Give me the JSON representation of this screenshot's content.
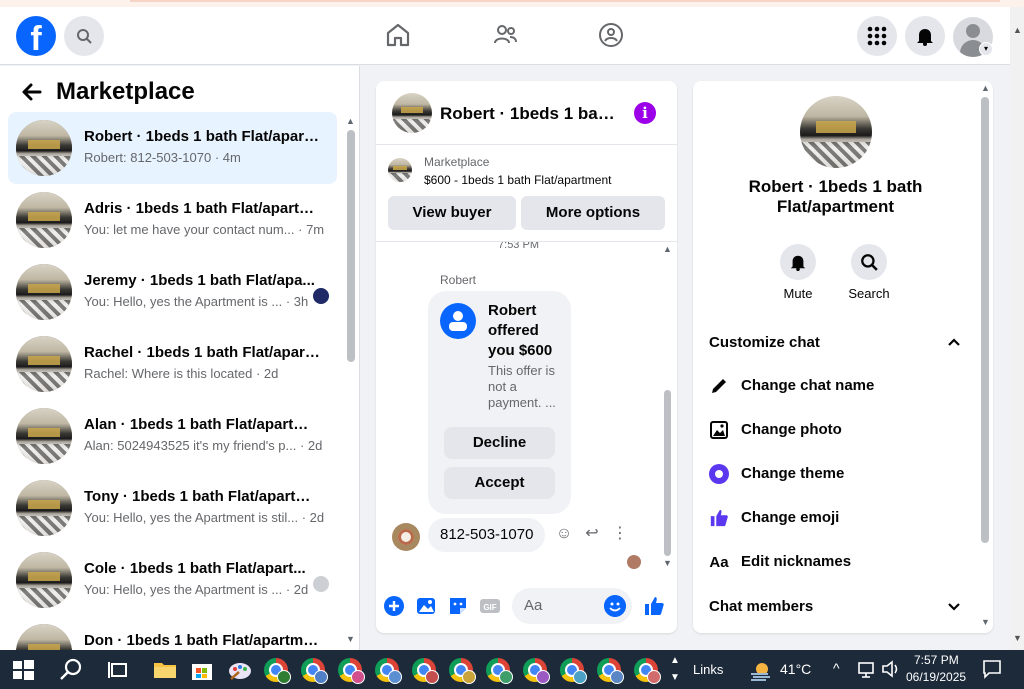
{
  "header": {
    "logo_letter": "f",
    "icons": [
      "search-icon",
      "home-icon",
      "friends-icon",
      "groups-icon",
      "menu-grid-icon",
      "bell-icon",
      "profile-avatar"
    ]
  },
  "left": {
    "title": "Marketplace",
    "threads": [
      {
        "name": "Robert · 1beds 1 bath Flat/apart...",
        "snippet": "Robert: 812-503-1070 · 4m",
        "active": true
      },
      {
        "name": "Adris · 1beds 1 bath Flat/apartm...",
        "snippet": "You: let me have your contact num... · 7m"
      },
      {
        "name": "Jeremy · 1beds 1 bath Flat/apa...",
        "snippet": "You: Hello, yes the Apartment is ... · 3h"
      },
      {
        "name": "Rachel · 1beds 1 bath Flat/apart...",
        "snippet": "Rachel: Where is this located · 2d"
      },
      {
        "name": "Alan · 1beds 1 bath Flat/apartment",
        "snippet": "Alan: 5024943525 it's my friend's p... · 2d"
      },
      {
        "name": "Tony · 1beds 1 bath Flat/apartme...",
        "snippet": "You: Hello, yes the Apartment is stil... · 2d"
      },
      {
        "name": "Cole · 1beds 1 bath Flat/apart...",
        "snippet": "You: Hello, yes the Apartment is ... · 2d"
      },
      {
        "name": "Don · 1beds 1 bath Flat/apartment",
        "snippet": ""
      }
    ]
  },
  "chat": {
    "title": "Robert · 1beds 1 bath Flat/apartment",
    "marketplace_label": "Marketplace",
    "listing": "$600 - 1beds 1 bath Flat/apartment",
    "view_buyer": "View buyer",
    "more_options": "More options",
    "timestamp": "7:53 PM",
    "sender": "Robert",
    "offer_title": "Robert offered you $600",
    "offer_sub": "This offer is not a payment. ...",
    "decline": "Decline",
    "accept": "Accept",
    "message": "812-503-1070",
    "composer_placeholder": "Aa",
    "composer_icons": [
      "plus-icon",
      "photo-icon",
      "sticker-icon",
      "gif-icon",
      "emoji-icon",
      "thumbs-up-icon"
    ]
  },
  "info": {
    "name": "Robert · 1beds 1 bath Flat/apartment",
    "mute": "Mute",
    "search": "Search",
    "customize": "Customize chat",
    "options": [
      "Change chat name",
      "Change photo",
      "Change theme",
      "Change emoji",
      "Edit nicknames"
    ],
    "members": "Chat members",
    "colors": {
      "theme": "#5b38f0",
      "accent": "#0866ff"
    }
  },
  "taskbar": {
    "links": "Links",
    "temp": "41°C",
    "time": "7:57 PM",
    "date": "06/19/2025"
  }
}
